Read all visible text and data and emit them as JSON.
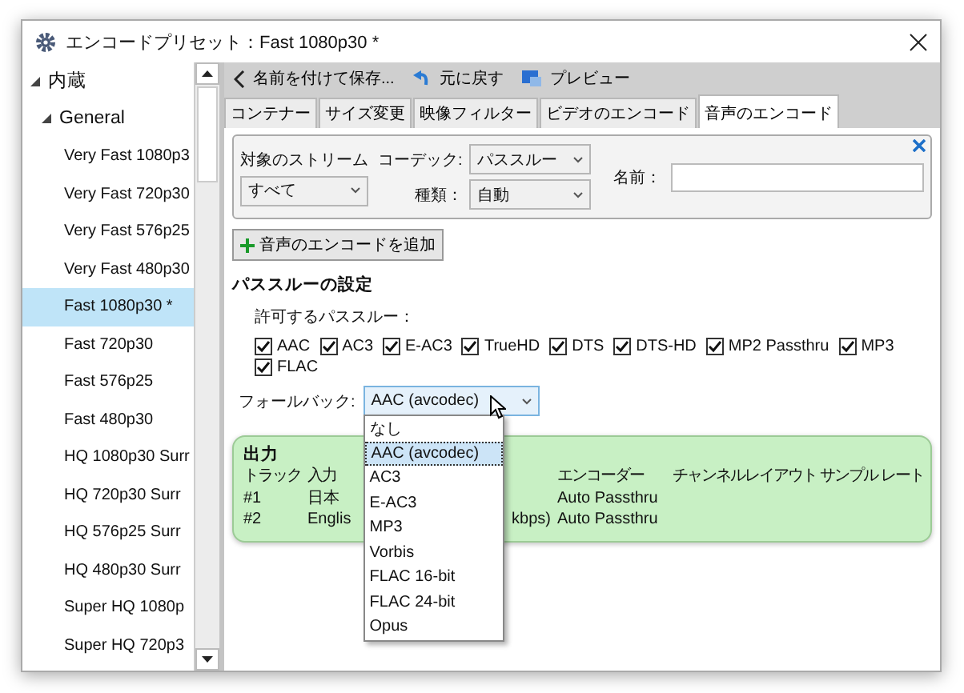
{
  "window": {
    "title": "エンコードプリセット：Fast 1080p30 *"
  },
  "sidebar": {
    "tree": [
      {
        "label": "内蔵",
        "expanded": true,
        "children": [
          {
            "label": "General",
            "expanded": true,
            "children": [
              {
                "label": "Very Fast 1080p3",
                "selected": false
              },
              {
                "label": "Very Fast 720p30",
                "selected": false
              },
              {
                "label": "Very Fast 576p25",
                "selected": false
              },
              {
                "label": "Very Fast 480p30",
                "selected": false
              },
              {
                "label": "Fast 1080p30 *",
                "selected": true
              },
              {
                "label": "Fast 720p30",
                "selected": false
              },
              {
                "label": "Fast 576p25",
                "selected": false
              },
              {
                "label": "Fast 480p30",
                "selected": false
              },
              {
                "label": "HQ 1080p30 Surr",
                "selected": false
              },
              {
                "label": "HQ 720p30 Surr",
                "selected": false
              },
              {
                "label": "HQ 576p25 Surr",
                "selected": false
              },
              {
                "label": "HQ 480p30 Surr",
                "selected": false
              },
              {
                "label": "Super HQ 1080p",
                "selected": false
              },
              {
                "label": "Super HQ 720p3",
                "selected": false
              }
            ]
          }
        ]
      }
    ]
  },
  "toolbar": [
    {
      "kind": "back",
      "label": "名前を付けて保存..."
    },
    {
      "kind": "undo",
      "label": "元に戻す"
    },
    {
      "kind": "preview",
      "label": "プレビュー"
    }
  ],
  "tabs": [
    {
      "label": "コンテナー",
      "selected": false
    },
    {
      "label": "サイズ変更",
      "selected": false
    },
    {
      "label": "映像フィルター",
      "selected": false
    },
    {
      "label": "ビデオのエンコード",
      "selected": false
    },
    {
      "label": "音声のエンコード",
      "selected": true
    }
  ],
  "track": {
    "stream_label": "対象のストリーム",
    "stream_value": "すべて",
    "codec_label": "コーデック:",
    "codec_value": "パススルー",
    "type_label": "種類：",
    "type_value": "自動",
    "name_label": "名前："
  },
  "add_button": "音声のエンコードを追加",
  "passthru": {
    "title": "パススルーの設定",
    "label": "許可するパススルー：",
    "options": [
      {
        "label": "AAC",
        "checked": true
      },
      {
        "label": "AC3",
        "checked": true
      },
      {
        "label": "E-AC3",
        "checked": true
      },
      {
        "label": "TrueHD",
        "checked": true
      },
      {
        "label": "DTS",
        "checked": true
      },
      {
        "label": "DTS-HD",
        "checked": true
      },
      {
        "label": "MP2 Passthru",
        "checked": true
      },
      {
        "label": "MP3",
        "checked": true
      },
      {
        "label": "FLAC",
        "checked": true
      }
    ]
  },
  "fallback": {
    "label": "フォールバック:",
    "value": "AAC (avcodec)",
    "expanded": true,
    "options": [
      {
        "label": "なし",
        "selected": false
      },
      {
        "label": "AAC (avcodec)",
        "selected": true
      },
      {
        "label": "AC3",
        "selected": false
      },
      {
        "label": "E-AC3",
        "selected": false
      },
      {
        "label": "MP3",
        "selected": false
      },
      {
        "label": "Vorbis",
        "selected": false
      },
      {
        "label": "FLAC 16-bit",
        "selected": false
      },
      {
        "label": "FLAC 24-bit",
        "selected": false
      },
      {
        "label": "Opus",
        "selected": false
      }
    ]
  },
  "output": {
    "title": "出力",
    "columns": [
      "トラック",
      "入力",
      "エンコーダー",
      "チャンネルレイアウト",
      "サンプル レート"
    ],
    "rows": [
      {
        "track": "#1",
        "input": "日本",
        "encoder": "Auto Passthru"
      },
      {
        "track": "#2",
        "input": "Englis",
        "input_end": "kbps)",
        "encoder": "Auto Passthru"
      }
    ]
  }
}
